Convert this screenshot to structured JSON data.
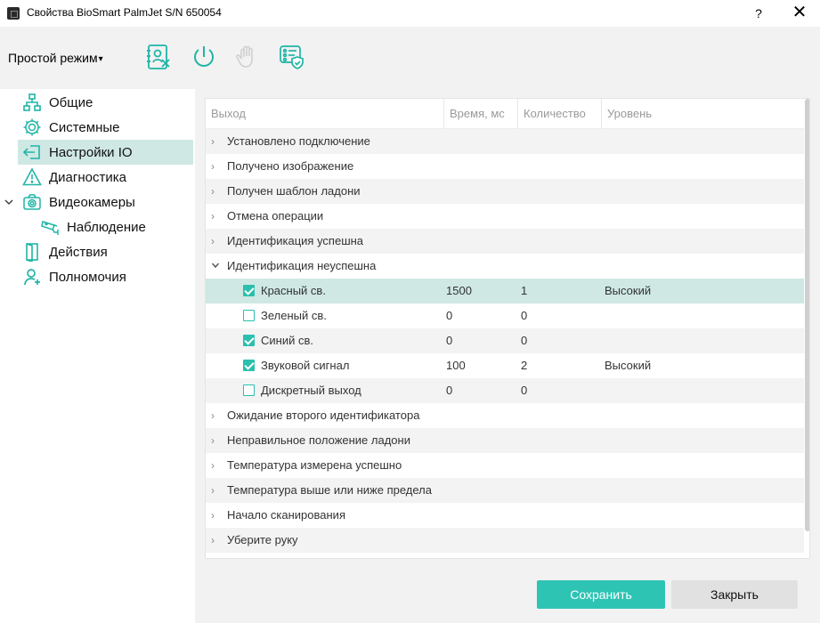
{
  "window": {
    "title": "Свойства BioSmart PalmJet S/N 650054",
    "help_label": "?",
    "close_label": "✕"
  },
  "toolbar": {
    "mode_label": "Простой режим",
    "mode_arrow": "▾",
    "icons": [
      "user-card-remove-icon",
      "power-restart-icon",
      "hand-stop-icon",
      "settings-shield-icon"
    ]
  },
  "sidebar": {
    "items": [
      {
        "label": "Общие",
        "icon": "network-icon"
      },
      {
        "label": "Системные",
        "icon": "gear-icon"
      },
      {
        "label": "Настройки IO",
        "icon": "io-arrow-icon"
      },
      {
        "label": "Диагностика",
        "icon": "warning-icon"
      },
      {
        "label": "Видеокамеры",
        "icon": "camera-icon"
      },
      {
        "label": "Наблюдение",
        "icon": "cctv-icon"
      },
      {
        "label": "Действия",
        "icon": "door-icon"
      },
      {
        "label": "Полномочия",
        "icon": "user-plus-icon"
      }
    ]
  },
  "grid": {
    "columns": [
      "Выход",
      "Время, мс",
      "Количество",
      "Уровень"
    ],
    "groups": [
      "Установлено подключение",
      "Получено изображение",
      "Получен шаблон ладони",
      "Отмена операции",
      "Идентификация успешна",
      "Идентификация неуспешна"
    ],
    "children": [
      {
        "label": "Красный св.",
        "time": "1500",
        "count": "1",
        "level": "Высокий",
        "checked": true
      },
      {
        "label": "Зеленый св.",
        "time": "0",
        "count": "0",
        "level": "",
        "checked": false
      },
      {
        "label": "Синий св.",
        "time": "0",
        "count": "0",
        "level": "",
        "checked": true
      },
      {
        "label": "Звуковой сигнал",
        "time": "100",
        "count": "2",
        "level": "Высокий",
        "checked": true
      },
      {
        "label": "Дискретный выход",
        "time": "0",
        "count": "0",
        "level": "",
        "checked": false
      }
    ],
    "groups_after": [
      "Ожидание второго идентификатора",
      "Неправильное положение ладони",
      "Температура измерена успешно",
      "Температура выше или ниже предела",
      "Начало сканирования",
      "Уберите руку"
    ]
  },
  "footer": {
    "save_label": "Сохранить",
    "close_label": "Закрыть"
  },
  "colors": {
    "accent": "#2ec4b4",
    "selection": "#cfe8e4"
  }
}
